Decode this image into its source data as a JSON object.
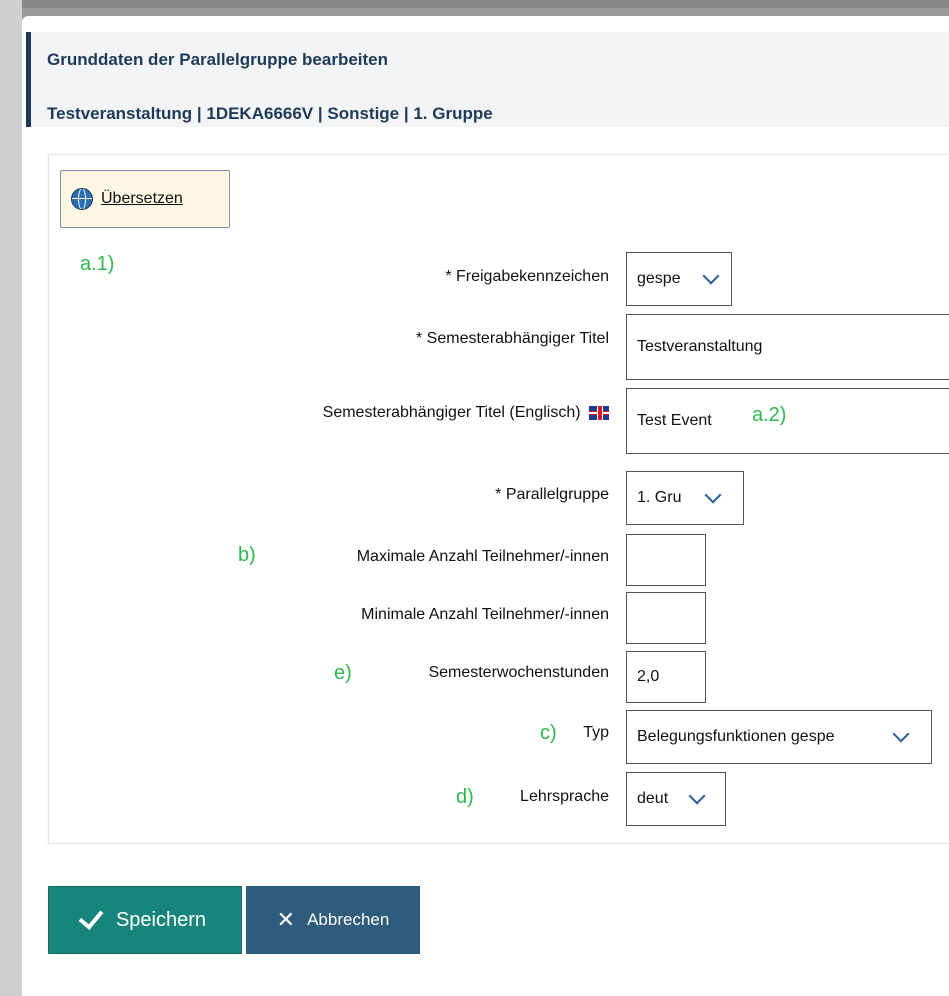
{
  "header": {
    "title": "Grunddaten der Parallelgruppe bearbeiten",
    "subtitle": "Testveranstaltung | 1DEKA6666V | Sonstige | 1. Gruppe"
  },
  "translate_button": {
    "label": "Übersetzen",
    "icon": "globe-icon"
  },
  "annotations": {
    "a1": "a.1)",
    "a2": "a.2)",
    "b": "b)",
    "e": "e)",
    "c": "c)",
    "d": "d)"
  },
  "form": {
    "freigabe": {
      "label": "* Freigabekennzeichen",
      "value": "gespe"
    },
    "title_de": {
      "label": "* Semesterabhängiger Titel",
      "value": "Testveranstaltung"
    },
    "title_en": {
      "label": "Semesterabhängiger Titel (Englisch)",
      "value": "Test Event",
      "flag": "uk-flag-icon"
    },
    "parallelgruppe": {
      "label": "* Parallelgruppe",
      "value": "1. Gru"
    },
    "max_teilnehmer": {
      "label": "Maximale Anzahl Teilnehmer/-innen",
      "value": ""
    },
    "min_teilnehmer": {
      "label": "Minimale Anzahl Teilnehmer/-innen",
      "value": ""
    },
    "sws": {
      "label": "Semesterwochenstunden",
      "value": "2,0"
    },
    "typ": {
      "label": "Typ",
      "value": "Belegungsfunktionen gespe"
    },
    "lehrsprache": {
      "label": "Lehrsprache",
      "value": "deut"
    }
  },
  "actions": {
    "save": "Speichern",
    "cancel": "Abbrechen"
  },
  "colors": {
    "accent_dark": "#1f3a57",
    "save_bg": "#17857b",
    "cancel_bg": "#2f5b7c",
    "annotation": "#2db84d"
  }
}
